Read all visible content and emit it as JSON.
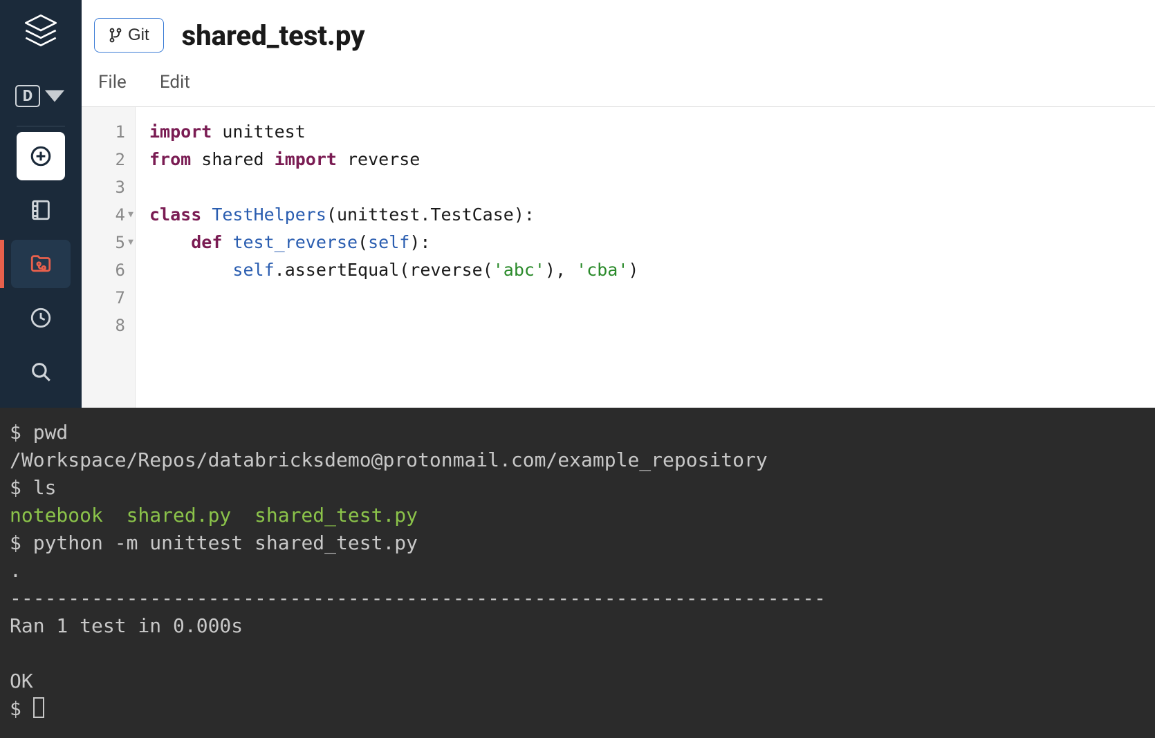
{
  "header": {
    "git_button_label": "Git",
    "file_title": "shared_test.py"
  },
  "menu": {
    "file": "File",
    "edit": "Edit"
  },
  "sidebar": {
    "d_label": "D"
  },
  "editor": {
    "lines": [
      "1",
      "2",
      "3",
      "4",
      "5",
      "6",
      "7",
      "8"
    ],
    "fold_lines": [
      "4",
      "5"
    ],
    "code": {
      "l1_kw": "import",
      "l1_rest": " unittest",
      "l2_kw1": "from",
      "l2_mid": " shared ",
      "l2_kw2": "import",
      "l2_rest": " reverse",
      "l4_kw": "class",
      "l4_sp": " ",
      "l4_cls": "TestHelpers",
      "l4_rest": "(unittest.TestCase):",
      "l5_indent": "    ",
      "l5_kw": "def",
      "l5_sp": " ",
      "l5_fn": "test_reverse",
      "l5_paren_open": "(",
      "l5_self": "self",
      "l5_paren_close": "):",
      "l6_indent": "        ",
      "l6_self": "self",
      "l6_mid1": ".assertEqual(reverse(",
      "l6_str1": "'abc'",
      "l6_mid2": "), ",
      "l6_str2": "'cba'",
      "l6_end": ")"
    }
  },
  "terminal": {
    "prompt": "$",
    "cmd_pwd": "pwd",
    "pwd_output": "/Workspace/Repos/databricksdemo@protonmail.com/example_repository",
    "cmd_ls": "ls",
    "ls_output": "notebook  shared.py  shared_test.py",
    "cmd_unittest": "python -m unittest shared_test.py",
    "dot": ".",
    "separator": "----------------------------------------------------------------------",
    "ran_line": "Ran 1 test in 0.000s",
    "ok_line": "OK"
  }
}
